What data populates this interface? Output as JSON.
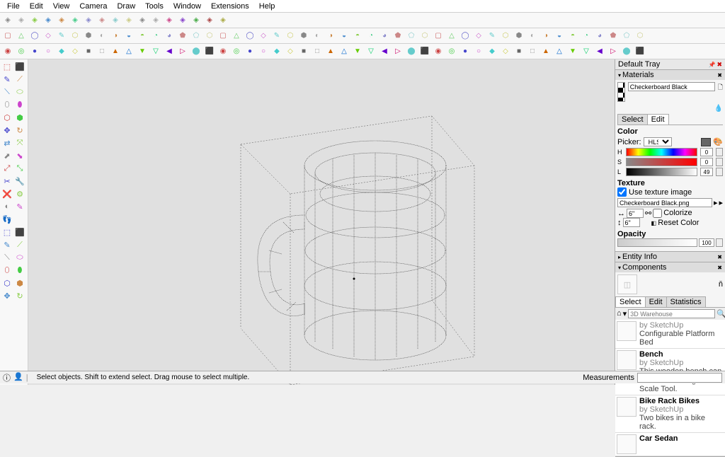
{
  "menu": [
    "File",
    "Edit",
    "View",
    "Camera",
    "Draw",
    "Tools",
    "Window",
    "Extensions",
    "Help"
  ],
  "tray": {
    "title": "Default Tray"
  },
  "materials": {
    "header": "Materials",
    "name": "Checkerboard Black",
    "tabs": [
      "Select",
      "Edit"
    ],
    "active_tab": "Edit",
    "color_label": "Color",
    "picker_label": "Picker:",
    "picker_value": "HLS",
    "h": "0",
    "s": "0",
    "l": "49",
    "texture_label": "Texture",
    "use_texture": "Use texture image",
    "texture_file": "Checkerboard Black.png",
    "dim1": "6\"",
    "dim2": "6\"",
    "colorize": "Colorize",
    "reset_color": "Reset Color",
    "opacity_label": "Opacity",
    "opacity_value": "100"
  },
  "panels": {
    "entity": "Entity Info",
    "components": "Components"
  },
  "components": {
    "tabs": [
      "Select",
      "Edit",
      "Statistics"
    ],
    "search_placeholder": "3D Warehouse",
    "items": [
      {
        "name": "",
        "by": "by SketchUp",
        "desc": "Configurable Platform Bed"
      },
      {
        "name": "Bench",
        "by": "by SketchUp",
        "desc": "This wooden bench can be resized using the Scale Tool."
      },
      {
        "name": "Bike Rack Bikes",
        "by": "by SketchUp",
        "desc": "Two bikes in a bike rack."
      },
      {
        "name": "Car Sedan",
        "by": "",
        "desc": ""
      }
    ]
  },
  "status": {
    "msg": "Select objects. Shift to extend select. Drag mouse to select multiple.",
    "meas_label": "Measurements"
  }
}
